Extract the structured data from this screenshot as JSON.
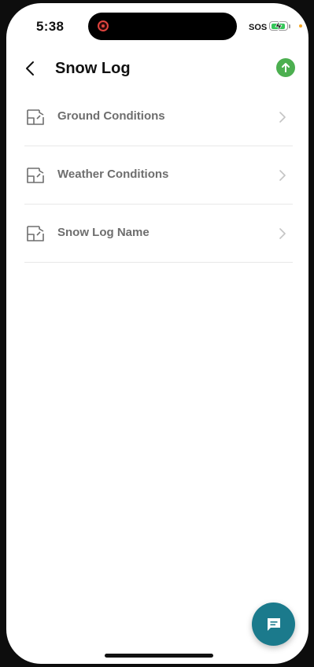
{
  "status_bar": {
    "time": "5:38",
    "carrier": "SOS",
    "battery_level": 0.9,
    "battery_color": "#34c759"
  },
  "header": {
    "title": "Snow Log",
    "back_icon": "chevron-left-icon",
    "upload_icon": "arrow-up-circle-icon",
    "upload_color": "#4caf50"
  },
  "list": {
    "items": [
      {
        "label": "Ground Conditions",
        "icon": "form-icon"
      },
      {
        "label": "Weather Conditions",
        "icon": "form-icon"
      },
      {
        "label": "Snow Log Name",
        "icon": "form-icon"
      }
    ]
  },
  "fab": {
    "icon": "chat-icon",
    "color": "#1b7a8c"
  }
}
